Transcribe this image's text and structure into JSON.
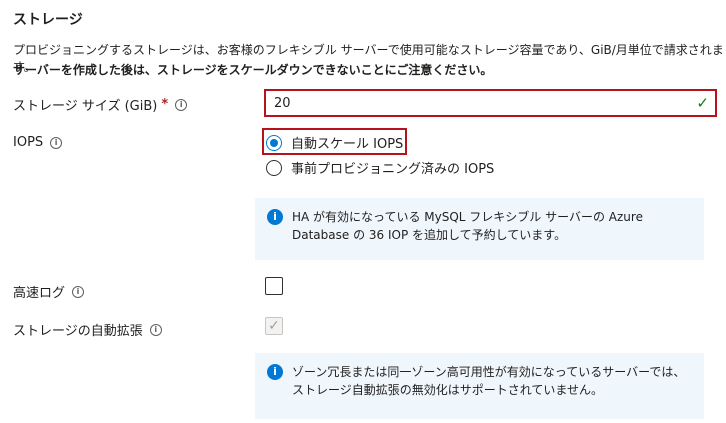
{
  "section": {
    "title": "ストレージ",
    "description": "プロビジョニングするストレージは、お客様のフレキシブル サーバーで使用可能なストレージ容量であり、GiB/月単位で請求されます。",
    "warning": "サーバーを作成した後は、ストレージをスケールダウンできないことにご注意ください。"
  },
  "storage_size": {
    "label": "ストレージ サイズ (GiB)",
    "required_mark": "*",
    "value": "20",
    "valid_icon": "checkmark-icon"
  },
  "iops": {
    "label": "IOPS",
    "options": [
      {
        "label": "自動スケール IOPS",
        "selected": true
      },
      {
        "label": "事前プロビジョニング済みの IOPS",
        "selected": false
      }
    ],
    "info": "HA が有効になっている MySQL フレキシブル サーバーの Azure Database の 36 IOP を追加して予約しています。"
  },
  "fast_log": {
    "label": "高速ログ",
    "checked": false
  },
  "auto_grow": {
    "label": "ストレージの自動拡張",
    "checked": true,
    "disabled": true,
    "info": "ゾーン冗長または同一ゾーン高可用性が有効になっているサーバーでは、ストレージ自動拡張の無効化はサポートされていません。"
  },
  "icons": {
    "info": "i",
    "check": "✓"
  },
  "colors": {
    "highlight": "#b4131d",
    "accent": "#0078d4",
    "valid": "#107c10",
    "info_bg": "#eff6fc"
  }
}
